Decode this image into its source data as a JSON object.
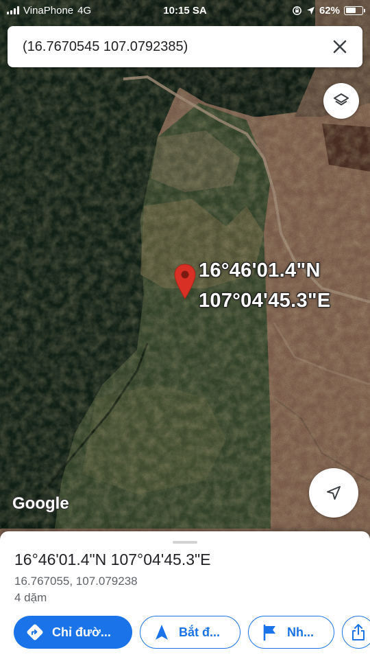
{
  "status_bar": {
    "carrier": "VinaPhone",
    "network": "4G",
    "time": "10:15 SA",
    "battery": "62%",
    "battery_level": 0.62
  },
  "search": {
    "query": "(16.7670545 107.0792385)",
    "close_icon": "close-icon"
  },
  "map": {
    "pin_label_lat": "16°46'01.4\"N",
    "pin_label_lng": "107°04'45.3\"E",
    "logo": "Google",
    "layers_icon": "layers-icon",
    "location_icon": "navigation-arrow-icon"
  },
  "place": {
    "title": "16°46'01.4\"N 107°04'45.3\"E",
    "decimal": "16.767055, 107.079238",
    "distance": "4 dặm"
  },
  "actions": {
    "directions": "Chỉ đườ...",
    "start": "Bắt đ...",
    "save": "Nh...",
    "share_icon": "share-icon"
  },
  "colors": {
    "accent": "#1a73e8",
    "pin": "#d93025",
    "forest_dark": "#14261a",
    "forest": "#2a4a2a",
    "clearing": "#6e6a48",
    "dirt": "#8a6b58"
  }
}
